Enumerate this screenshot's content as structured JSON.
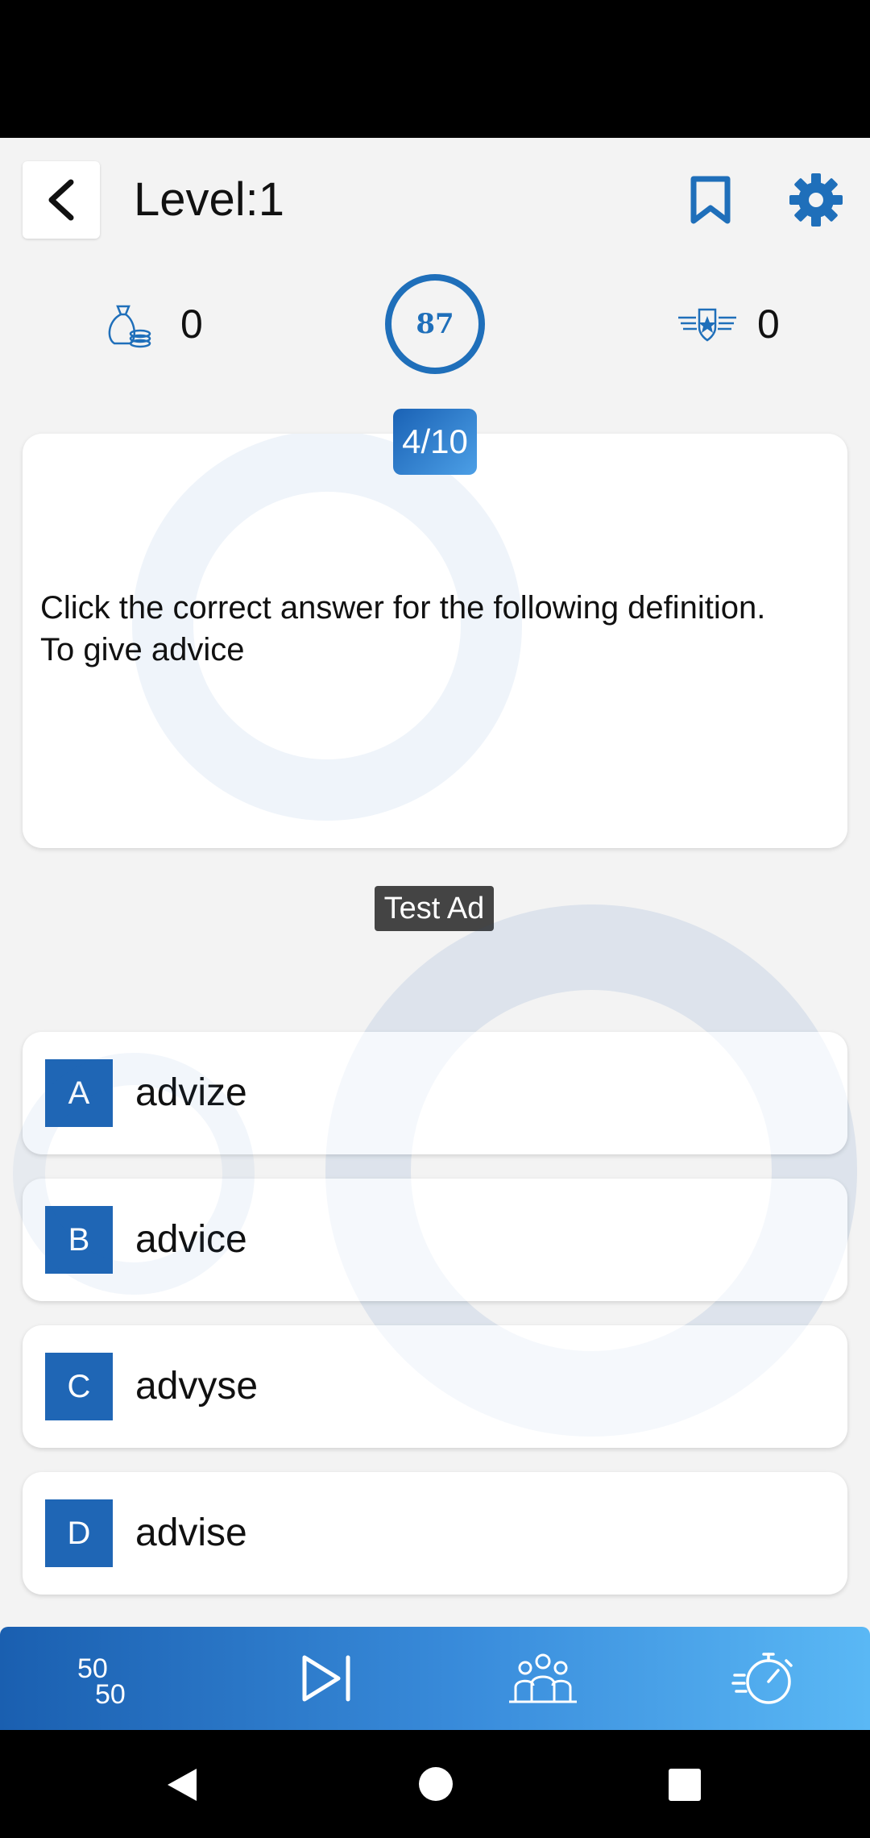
{
  "header": {
    "title": "Level:1",
    "back_icon": "chevron-left-icon",
    "bookmark_icon": "bookmark-icon",
    "settings_icon": "gear-icon"
  },
  "stats": {
    "coins": "0",
    "timer": "87",
    "score": "0"
  },
  "question": {
    "progress": "4/10",
    "text": "Click the correct answer for the following definition. To give advice"
  },
  "ad": {
    "label": "Test Ad"
  },
  "options": [
    {
      "letter": "A",
      "text": "advize"
    },
    {
      "letter": "B",
      "text": "advice"
    },
    {
      "letter": "C",
      "text": "advyse"
    },
    {
      "letter": "D",
      "text": "advise"
    }
  ],
  "lifelines": {
    "fifty_fifty": "5050",
    "icons": [
      "fifty-fifty-icon",
      "skip-icon",
      "audience-icon",
      "timer-icon"
    ]
  },
  "colors": {
    "accent": "#1f6fba",
    "gradient_start": "#1a5fb0",
    "gradient_end": "#5ab8f5"
  }
}
